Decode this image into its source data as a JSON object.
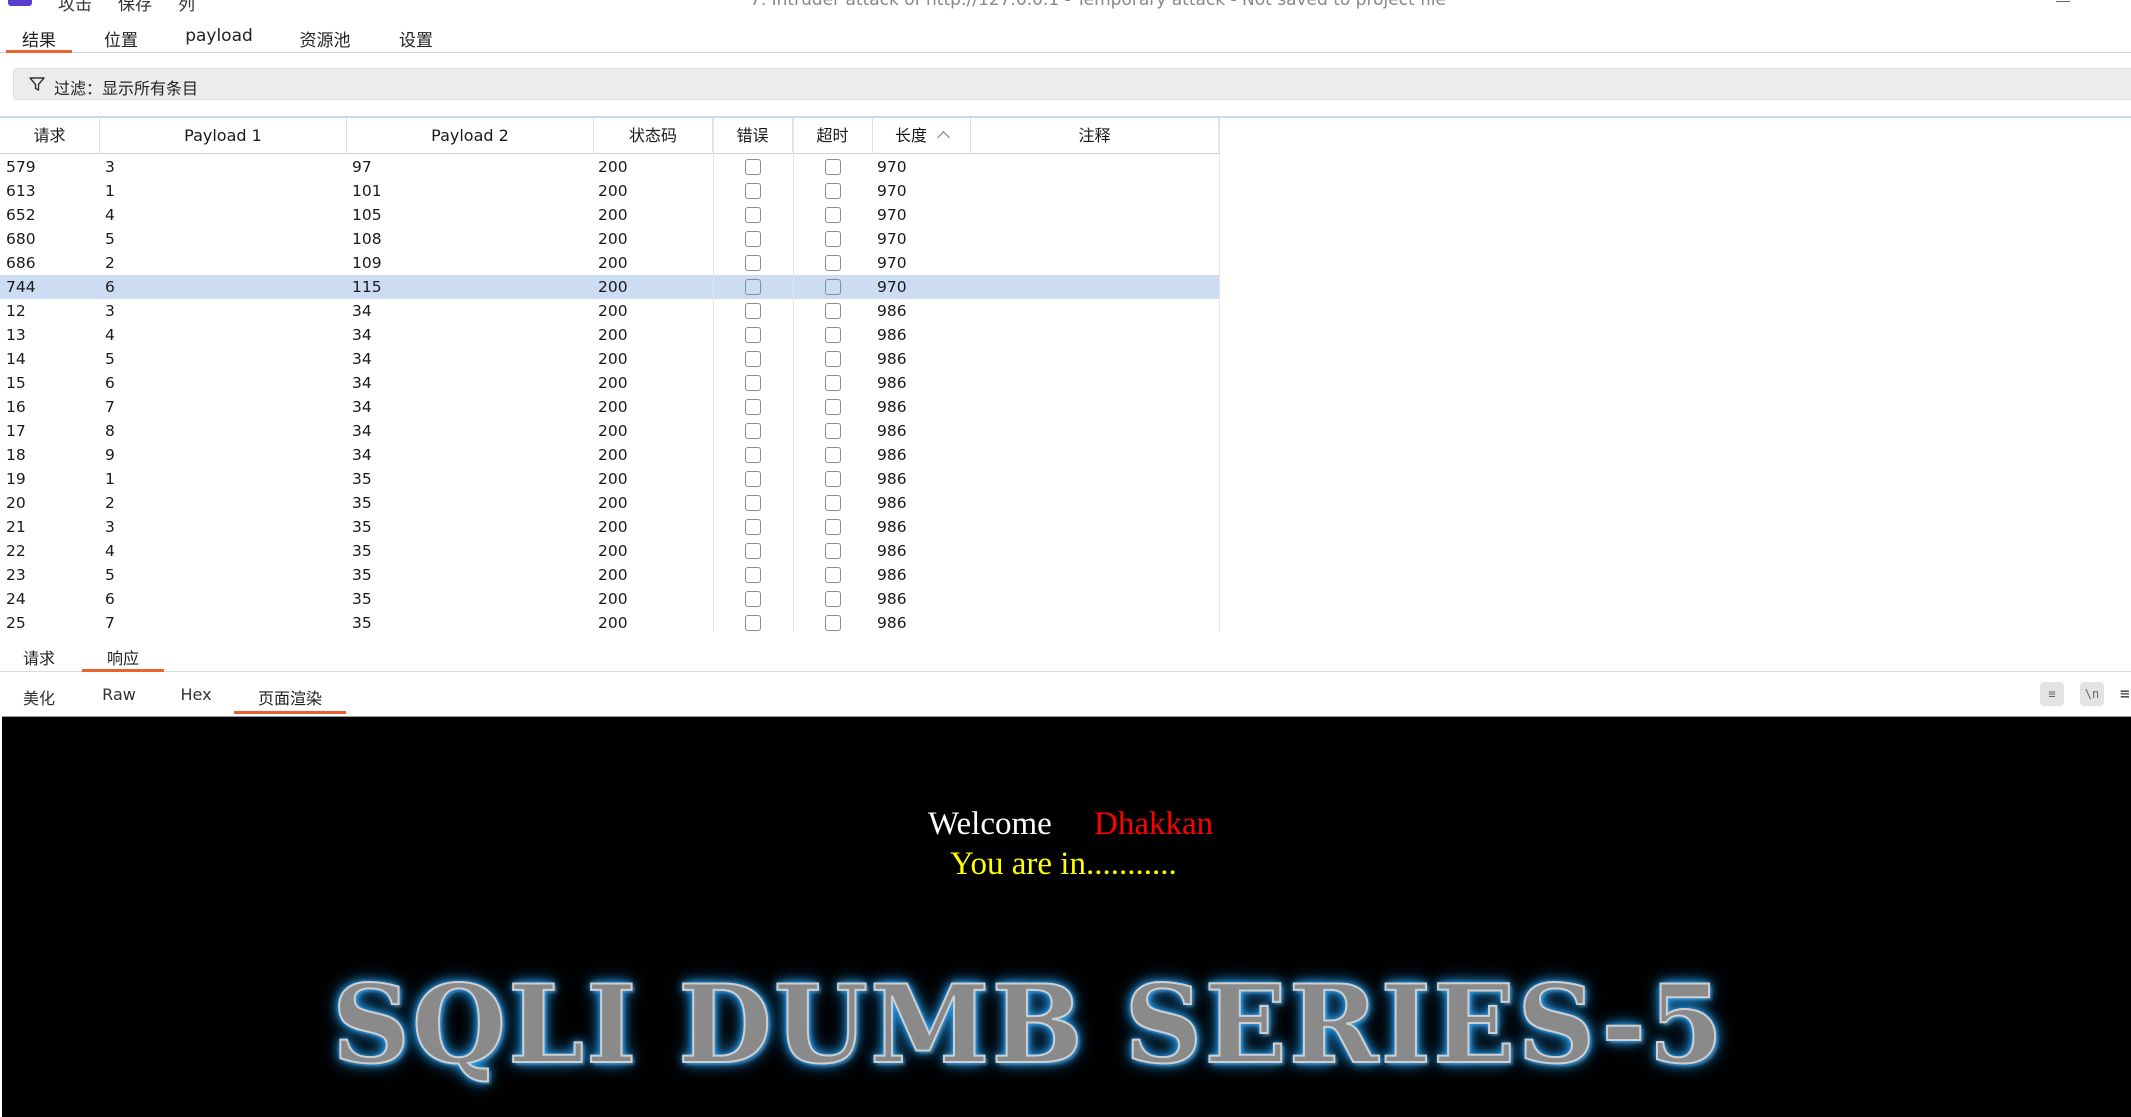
{
  "window": {
    "menu": [
      "攻击",
      "保存",
      "列"
    ],
    "title": "7. Intruder attack of http://127.0.0.1 - Temporary attack - Not saved to project file"
  },
  "top_tabs": [
    {
      "label": "结果",
      "active": true
    },
    {
      "label": "位置",
      "active": false
    },
    {
      "label": "payload",
      "active": false
    },
    {
      "label": "资源池",
      "active": false
    },
    {
      "label": "设置",
      "active": false
    }
  ],
  "filter": {
    "text": "过滤：显示所有条目"
  },
  "table": {
    "columns": [
      "请求",
      "Payload 1",
      "Payload 2",
      "状态码",
      "错误",
      "超时",
      "长度",
      "注释"
    ],
    "sort_column": "长度",
    "selected_request": "744",
    "rows": [
      {
        "request": "579",
        "payload1": "3",
        "payload2": "97",
        "status": "200",
        "error": false,
        "timeout": false,
        "length": "970",
        "comment": ""
      },
      {
        "request": "613",
        "payload1": "1",
        "payload2": "101",
        "status": "200",
        "error": false,
        "timeout": false,
        "length": "970",
        "comment": ""
      },
      {
        "request": "652",
        "payload1": "4",
        "payload2": "105",
        "status": "200",
        "error": false,
        "timeout": false,
        "length": "970",
        "comment": ""
      },
      {
        "request": "680",
        "payload1": "5",
        "payload2": "108",
        "status": "200",
        "error": false,
        "timeout": false,
        "length": "970",
        "comment": ""
      },
      {
        "request": "686",
        "payload1": "2",
        "payload2": "109",
        "status": "200",
        "error": false,
        "timeout": false,
        "length": "970",
        "comment": ""
      },
      {
        "request": "744",
        "payload1": "6",
        "payload2": "115",
        "status": "200",
        "error": false,
        "timeout": false,
        "length": "970",
        "comment": ""
      },
      {
        "request": "12",
        "payload1": "3",
        "payload2": "34",
        "status": "200",
        "error": false,
        "timeout": false,
        "length": "986",
        "comment": ""
      },
      {
        "request": "13",
        "payload1": "4",
        "payload2": "34",
        "status": "200",
        "error": false,
        "timeout": false,
        "length": "986",
        "comment": ""
      },
      {
        "request": "14",
        "payload1": "5",
        "payload2": "34",
        "status": "200",
        "error": false,
        "timeout": false,
        "length": "986",
        "comment": ""
      },
      {
        "request": "15",
        "payload1": "6",
        "payload2": "34",
        "status": "200",
        "error": false,
        "timeout": false,
        "length": "986",
        "comment": ""
      },
      {
        "request": "16",
        "payload1": "7",
        "payload2": "34",
        "status": "200",
        "error": false,
        "timeout": false,
        "length": "986",
        "comment": ""
      },
      {
        "request": "17",
        "payload1": "8",
        "payload2": "34",
        "status": "200",
        "error": false,
        "timeout": false,
        "length": "986",
        "comment": ""
      },
      {
        "request": "18",
        "payload1": "9",
        "payload2": "34",
        "status": "200",
        "error": false,
        "timeout": false,
        "length": "986",
        "comment": ""
      },
      {
        "request": "19",
        "payload1": "1",
        "payload2": "35",
        "status": "200",
        "error": false,
        "timeout": false,
        "length": "986",
        "comment": ""
      },
      {
        "request": "20",
        "payload1": "2",
        "payload2": "35",
        "status": "200",
        "error": false,
        "timeout": false,
        "length": "986",
        "comment": ""
      },
      {
        "request": "21",
        "payload1": "3",
        "payload2": "35",
        "status": "200",
        "error": false,
        "timeout": false,
        "length": "986",
        "comment": ""
      },
      {
        "request": "22",
        "payload1": "4",
        "payload2": "35",
        "status": "200",
        "error": false,
        "timeout": false,
        "length": "986",
        "comment": ""
      },
      {
        "request": "23",
        "payload1": "5",
        "payload2": "35",
        "status": "200",
        "error": false,
        "timeout": false,
        "length": "986",
        "comment": ""
      },
      {
        "request": "24",
        "payload1": "6",
        "payload2": "35",
        "status": "200",
        "error": false,
        "timeout": false,
        "length": "986",
        "comment": ""
      },
      {
        "request": "25",
        "payload1": "7",
        "payload2": "35",
        "status": "200",
        "error": false,
        "timeout": false,
        "length": "986",
        "comment": ""
      }
    ]
  },
  "detail_tabs": [
    {
      "label": "请求",
      "active": false
    },
    {
      "label": "响应",
      "active": true
    }
  ],
  "view_tabs": [
    {
      "label": "美化",
      "active": false
    },
    {
      "label": "Raw",
      "active": false
    },
    {
      "label": "Hex",
      "active": false
    },
    {
      "label": "页面渲染",
      "active": true
    }
  ],
  "toolbar_icons": [
    "wrap-lines-icon",
    "newline-toggle-icon",
    "more-menu-icon"
  ],
  "toolbar_icon_glyphs": [
    "≡",
    "\\n"
  ],
  "rendered_page": {
    "welcome": "Welcome",
    "user": "Dhakkan",
    "message": "You are in...........",
    "banner": "SQLI DUMB SERIES-5",
    "colors": {
      "background": "#000000",
      "welcome": "#ffffff",
      "user": "#ff0000",
      "message": "#ffff00",
      "banner_glow": "#2aa7ff"
    }
  },
  "colors": {
    "accent": "#e8632f",
    "selected_row": "#cbdcf3",
    "filter_bg": "#ececec"
  }
}
